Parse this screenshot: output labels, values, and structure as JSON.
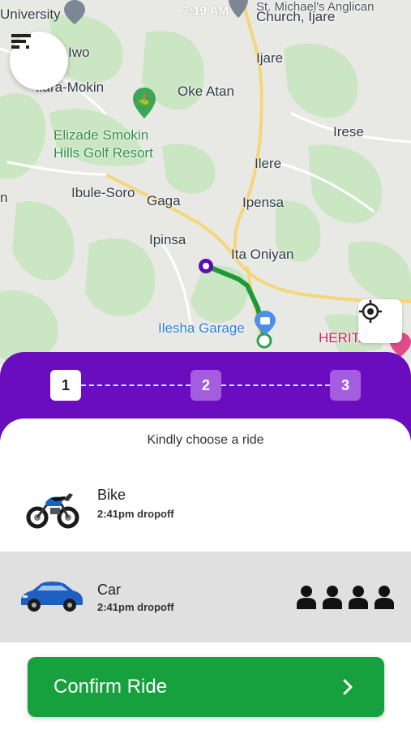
{
  "status_bar": {
    "time": "7:19 AM"
  },
  "map": {
    "labels": {
      "university": "University",
      "iwo": "Iwo",
      "ilara_mokin": "Ilara-Mokin",
      "oke_atan": "Oke Atan",
      "ijare": "Ijare",
      "church": "Church, Ijare",
      "st_michaels": "St. Michael's Anglican",
      "irese": "Irese",
      "elizade_line1": "Elizade Smokin",
      "elizade_line2": "Hills Golf Resort",
      "ilere": "Ilere",
      "ibule_soro": "Ibule-Soro",
      "gaga": "Gaga",
      "ipensa": "Ipensa",
      "ipinsa": "Ipinsa",
      "ita_oniyan": "Ita Oniyan",
      "ilesha_garage": "Ilesha Garage",
      "heritage": "HERITAGE",
      "left_fragment": "n"
    },
    "route_color": "#1a9a3c",
    "origin_color": "#5b0fb5"
  },
  "controls": {
    "menu_icon": "filter-menu-icon",
    "locate_icon": "crosshair-icon"
  },
  "stepper": {
    "steps": [
      "1",
      "2",
      "3"
    ],
    "active_index": 0,
    "color": "#6a0dbe"
  },
  "panel": {
    "subtitle": "Kindly choose a ride",
    "rides": [
      {
        "name": "Bike",
        "eta": "2:41pm dropoff",
        "icon": "motorbike-image",
        "selected": false
      },
      {
        "name": "Car",
        "eta": "2:41pm dropoff",
        "icon": "car-image",
        "selected": true,
        "seats": 4
      }
    ]
  },
  "confirm": {
    "label": "Confirm Ride",
    "color": "#16a03e"
  }
}
